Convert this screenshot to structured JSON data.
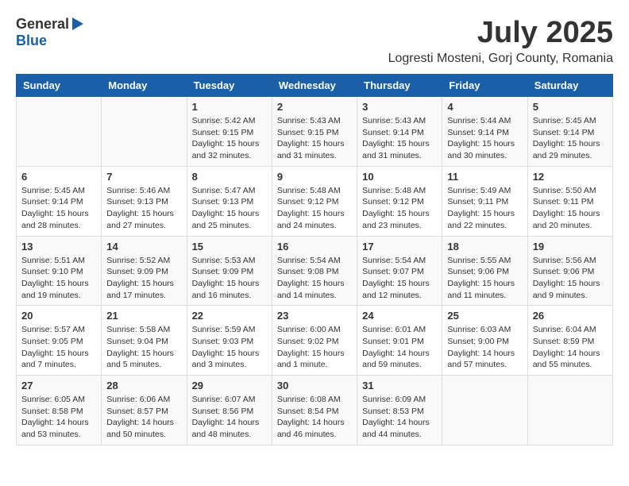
{
  "header": {
    "logo_general": "General",
    "logo_blue": "Blue",
    "month_title": "July 2025",
    "location": "Logresti Mosteni, Gorj County, Romania"
  },
  "calendar": {
    "days_of_week": [
      "Sunday",
      "Monday",
      "Tuesday",
      "Wednesday",
      "Thursday",
      "Friday",
      "Saturday"
    ],
    "weeks": [
      {
        "days": [
          {
            "number": "",
            "info": ""
          },
          {
            "number": "",
            "info": ""
          },
          {
            "number": "1",
            "info": "Sunrise: 5:42 AM\nSunset: 9:15 PM\nDaylight: 15 hours\nand 32 minutes."
          },
          {
            "number": "2",
            "info": "Sunrise: 5:43 AM\nSunset: 9:15 PM\nDaylight: 15 hours\nand 31 minutes."
          },
          {
            "number": "3",
            "info": "Sunrise: 5:43 AM\nSunset: 9:14 PM\nDaylight: 15 hours\nand 31 minutes."
          },
          {
            "number": "4",
            "info": "Sunrise: 5:44 AM\nSunset: 9:14 PM\nDaylight: 15 hours\nand 30 minutes."
          },
          {
            "number": "5",
            "info": "Sunrise: 5:45 AM\nSunset: 9:14 PM\nDaylight: 15 hours\nand 29 minutes."
          }
        ]
      },
      {
        "days": [
          {
            "number": "6",
            "info": "Sunrise: 5:45 AM\nSunset: 9:14 PM\nDaylight: 15 hours\nand 28 minutes."
          },
          {
            "number": "7",
            "info": "Sunrise: 5:46 AM\nSunset: 9:13 PM\nDaylight: 15 hours\nand 27 minutes."
          },
          {
            "number": "8",
            "info": "Sunrise: 5:47 AM\nSunset: 9:13 PM\nDaylight: 15 hours\nand 25 minutes."
          },
          {
            "number": "9",
            "info": "Sunrise: 5:48 AM\nSunset: 9:12 PM\nDaylight: 15 hours\nand 24 minutes."
          },
          {
            "number": "10",
            "info": "Sunrise: 5:48 AM\nSunset: 9:12 PM\nDaylight: 15 hours\nand 23 minutes."
          },
          {
            "number": "11",
            "info": "Sunrise: 5:49 AM\nSunset: 9:11 PM\nDaylight: 15 hours\nand 22 minutes."
          },
          {
            "number": "12",
            "info": "Sunrise: 5:50 AM\nSunset: 9:11 PM\nDaylight: 15 hours\nand 20 minutes."
          }
        ]
      },
      {
        "days": [
          {
            "number": "13",
            "info": "Sunrise: 5:51 AM\nSunset: 9:10 PM\nDaylight: 15 hours\nand 19 minutes."
          },
          {
            "number": "14",
            "info": "Sunrise: 5:52 AM\nSunset: 9:09 PM\nDaylight: 15 hours\nand 17 minutes."
          },
          {
            "number": "15",
            "info": "Sunrise: 5:53 AM\nSunset: 9:09 PM\nDaylight: 15 hours\nand 16 minutes."
          },
          {
            "number": "16",
            "info": "Sunrise: 5:54 AM\nSunset: 9:08 PM\nDaylight: 15 hours\nand 14 minutes."
          },
          {
            "number": "17",
            "info": "Sunrise: 5:54 AM\nSunset: 9:07 PM\nDaylight: 15 hours\nand 12 minutes."
          },
          {
            "number": "18",
            "info": "Sunrise: 5:55 AM\nSunset: 9:06 PM\nDaylight: 15 hours\nand 11 minutes."
          },
          {
            "number": "19",
            "info": "Sunrise: 5:56 AM\nSunset: 9:06 PM\nDaylight: 15 hours\nand 9 minutes."
          }
        ]
      },
      {
        "days": [
          {
            "number": "20",
            "info": "Sunrise: 5:57 AM\nSunset: 9:05 PM\nDaylight: 15 hours\nand 7 minutes."
          },
          {
            "number": "21",
            "info": "Sunrise: 5:58 AM\nSunset: 9:04 PM\nDaylight: 15 hours\nand 5 minutes."
          },
          {
            "number": "22",
            "info": "Sunrise: 5:59 AM\nSunset: 9:03 PM\nDaylight: 15 hours\nand 3 minutes."
          },
          {
            "number": "23",
            "info": "Sunrise: 6:00 AM\nSunset: 9:02 PM\nDaylight: 15 hours\nand 1 minute."
          },
          {
            "number": "24",
            "info": "Sunrise: 6:01 AM\nSunset: 9:01 PM\nDaylight: 14 hours\nand 59 minutes."
          },
          {
            "number": "25",
            "info": "Sunrise: 6:03 AM\nSunset: 9:00 PM\nDaylight: 14 hours\nand 57 minutes."
          },
          {
            "number": "26",
            "info": "Sunrise: 6:04 AM\nSunset: 8:59 PM\nDaylight: 14 hours\nand 55 minutes."
          }
        ]
      },
      {
        "days": [
          {
            "number": "27",
            "info": "Sunrise: 6:05 AM\nSunset: 8:58 PM\nDaylight: 14 hours\nand 53 minutes."
          },
          {
            "number": "28",
            "info": "Sunrise: 6:06 AM\nSunset: 8:57 PM\nDaylight: 14 hours\nand 50 minutes."
          },
          {
            "number": "29",
            "info": "Sunrise: 6:07 AM\nSunset: 8:56 PM\nDaylight: 14 hours\nand 48 minutes."
          },
          {
            "number": "30",
            "info": "Sunrise: 6:08 AM\nSunset: 8:54 PM\nDaylight: 14 hours\nand 46 minutes."
          },
          {
            "number": "31",
            "info": "Sunrise: 6:09 AM\nSunset: 8:53 PM\nDaylight: 14 hours\nand 44 minutes."
          },
          {
            "number": "",
            "info": ""
          },
          {
            "number": "",
            "info": ""
          }
        ]
      }
    ]
  }
}
